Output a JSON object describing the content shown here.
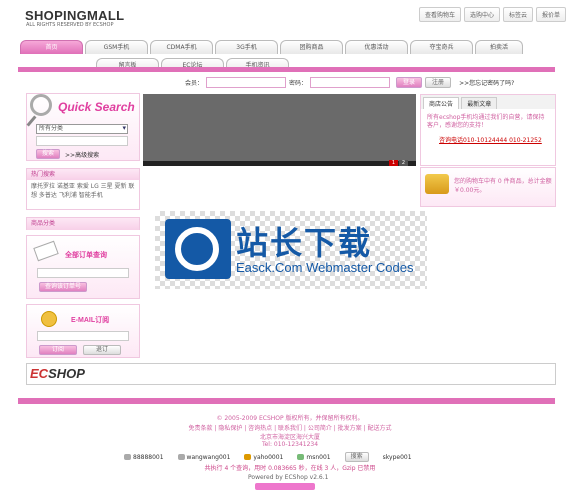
{
  "brand": {
    "logo": "SHOPINGMALL",
    "logo_gray": "MALL",
    "tagline": "ALL RIGHTS RESERVED BY ECSHOP"
  },
  "toplinks": [
    "查看购物车",
    "选购中心",
    "标签云",
    "报价单"
  ],
  "nav": {
    "row1": [
      "首页",
      "GSM手机",
      "CDMA手机",
      "3G手机",
      "团购商品",
      "优惠活动",
      "夺宝奇兵",
      "拍卖活"
    ],
    "row2": [
      "留言板",
      "EC论坛",
      "手机资讯"
    ]
  },
  "login": {
    "member": "会员：",
    "password": "密码：",
    "login_btn": "登录",
    "register_btn": "注册",
    "forgot": ">>您忘记密码了吗?"
  },
  "quick_search": {
    "title": "Quick Search",
    "category": "所有分类",
    "search_btn": "搜索",
    "advanced": ">>高级搜索"
  },
  "hot": {
    "title": "热门搜索",
    "words": "摩托罗拉  诺基亚  索爱  LG  三星  夏新  联想  多普达  飞利浦  智能手机"
  },
  "category": {
    "title": "商品分类"
  },
  "order_query": {
    "title": "全部订单查询",
    "btn": "查询该订单号"
  },
  "email": {
    "title": "E-MAIL订阅",
    "sub_btn": "订阅",
    "unsub_btn": "退订"
  },
  "slideshow": {
    "n1": "1",
    "n2": "2"
  },
  "notice": {
    "tab1": "商店公告",
    "tab2": "最新文章",
    "text": "所有ecshop手机均通过我们的自营，请保持客户，感谢您的支持！",
    "phone": "咨询电话010-10124444  010-21252"
  },
  "cart": {
    "text": "您的购物车中有 0 件商品，总计金额 ￥0.00元。"
  },
  "banner": {
    "cn": "站长下载",
    "en": "Easck.Com Webmaster Codes"
  },
  "ecshop": {
    "logo_a": "EC",
    "logo_b": "SHOP"
  },
  "footer": {
    "copyright": "© 2005-2009 ECSHOP 版权所有，并保留所有权利。",
    "links": "免责条款  |  隐私保护  |  咨询热点  |  联系我们  |  公司简介  |  批发方案  |  配送方式",
    "address": "北京市海淀区海兴大厦",
    "tel": "Tel: 010-12341234",
    "im": [
      "88888001",
      "wangwang001",
      "yaho0001",
      "msn001",
      "skype001"
    ],
    "search_btn": "搜索",
    "stats": "共执行 4 个查询，用时 0.083665 秒，在线 3 人，Gzip 已禁用",
    "powered": "Powered by ECShop v2.6.1"
  }
}
